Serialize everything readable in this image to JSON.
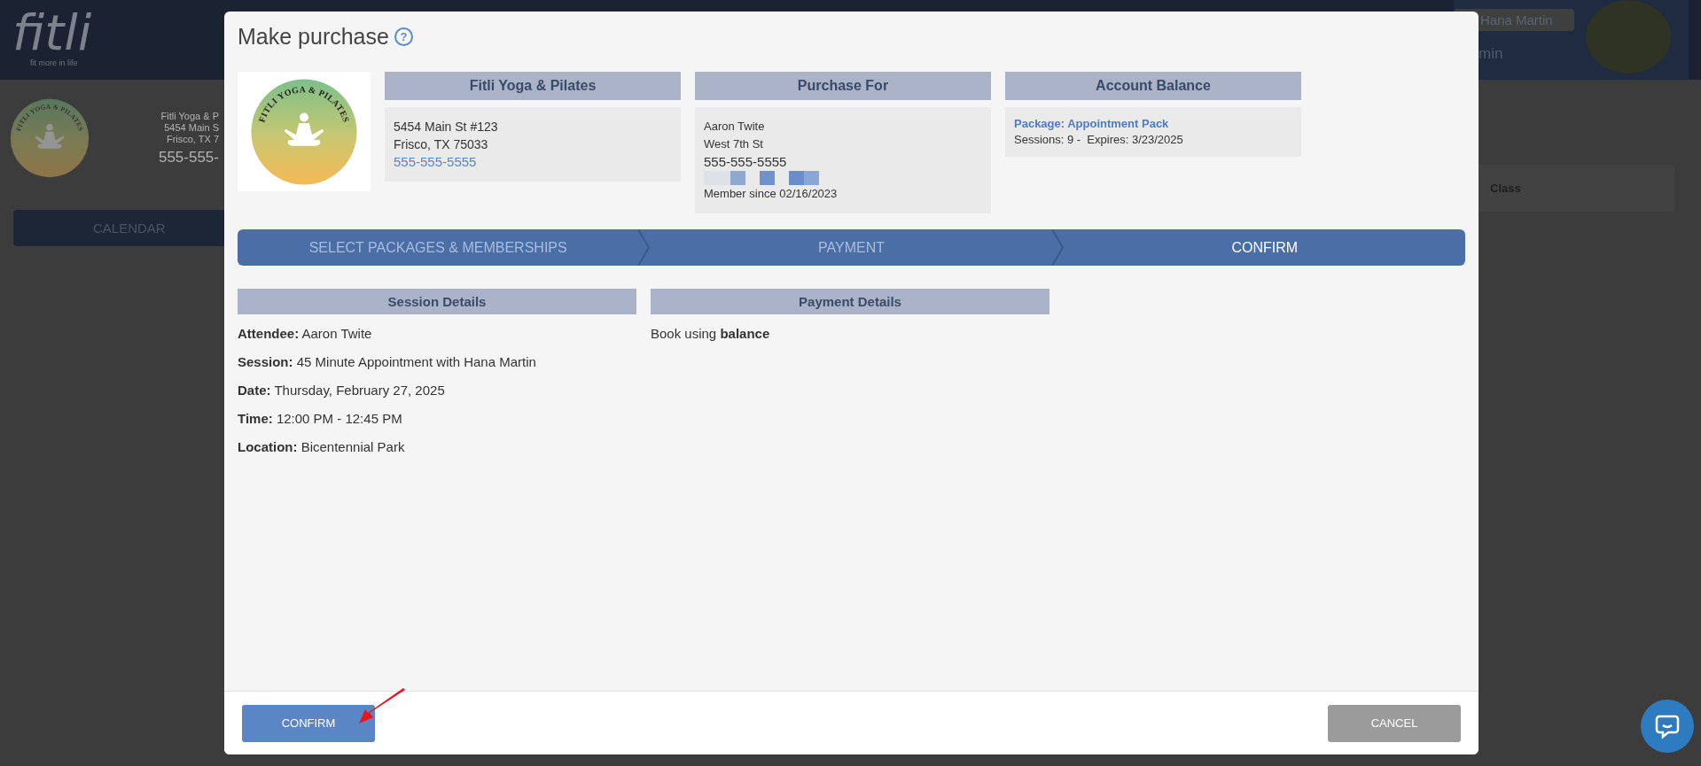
{
  "app_header": {
    "logo": "fitli",
    "tagline": "fit more in life",
    "user_name": "Hana Martin",
    "role_partial": "min"
  },
  "background_studio": {
    "logo_text": "FITLI YOGA & PILATES",
    "lines": [
      "Fitli Yoga & P",
      "5454 Main S",
      "Frisco, TX 7"
    ],
    "phone": "555-555-"
  },
  "nav": [
    {
      "label": "CALENDAR"
    }
  ],
  "side_card": {
    "label": "Class"
  },
  "modal": {
    "title": "Make purchase",
    "help": "?",
    "logo_text": "FITLI YOGA & PILATES",
    "studio": {
      "heading": "Fitli Yoga & Pilates",
      "lines": [
        "5454 Main St #123",
        "Frisco, TX 75033"
      ],
      "phone": "555-555-5555"
    },
    "purchase_for": {
      "heading": "Purchase For",
      "name": "Aaron Twite",
      "street": "West 7th St",
      "phone": "555-555-5555",
      "member_since": "Member since 02/16/2023"
    },
    "account_balance": {
      "heading": "Account Balance",
      "package": "Package: Appointment Pack",
      "sessions": "Sessions: 9 -  Expires: 3/23/2025"
    },
    "steps": [
      {
        "label": "SELECT PACKAGES & MEMBERSHIPS",
        "selected": false
      },
      {
        "label": "PAYMENT",
        "selected": false
      },
      {
        "label": "CONFIRM",
        "selected": true
      }
    ],
    "session_details": {
      "heading": "Session Details",
      "lines": [
        "**Attendee:** Aaron Twite",
        "**Session:** 45 Minute Appointment with Hana Martin",
        "**Date:** Thursday, February 27, 2025",
        "**Time:** 12:00 PM - 12:45 PM",
        "**Location:** Bicentennial Park"
      ]
    },
    "payment_details": {
      "heading": "Payment Details",
      "text": "Book using **balance**"
    },
    "buttons": [
      {
        "label": "CONFIRM",
        "kind": "primary"
      },
      {
        "label": "CANCEL",
        "kind": "secondary"
      }
    ]
  }
}
